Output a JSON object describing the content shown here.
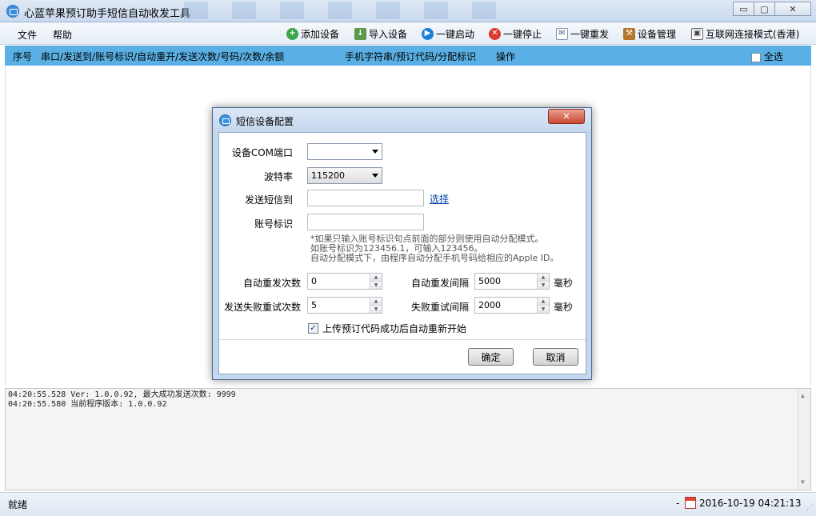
{
  "window": {
    "title": "心蓝苹果预订助手短信自动收发工具",
    "minimize": "▭",
    "maximize": "▢",
    "close": "✕"
  },
  "menu": {
    "file": "文件",
    "help": "帮助"
  },
  "toolbar": {
    "add_device": "添加设备",
    "import_device": "导入设备",
    "start_all": "一键启动",
    "stop_all": "一键停止",
    "resend_all": "一键重发",
    "device_manage": "设备管理",
    "internet_mode": "互联网连接模式(香港)"
  },
  "icons": {
    "add": "+",
    "import": "↓",
    "start": "▶",
    "stop": "✕",
    "resend": "✉",
    "manage": "⚒",
    "net": "▣"
  },
  "list_header": {
    "index": "序号",
    "port_info": "串口/发送到/账号标识/自动重开/发送次数/号码/次数/余额",
    "phone_info": "手机字符串/预订代码/分配标识",
    "action": "操作",
    "select_all": "全选"
  },
  "log": {
    "lines": [
      "04:20:55.528 Ver: 1.0.0.92, 最大成功发送次数: 9999",
      "04:20:55.580 当前程序版本: 1.0.0.92"
    ]
  },
  "statusbar": {
    "status": "就绪",
    "dash": "-",
    "datetime": "2016-10-19 04:21:13"
  },
  "dialog": {
    "title": "短信设备配置",
    "close": "✕",
    "com_port_label": "设备COM端口",
    "com_port_value": "",
    "baud_label": "波特率",
    "baud_value": "115200",
    "send_to_label": "发送短信到",
    "send_to_value": "",
    "select_link": "选择",
    "account_label": "账号标识",
    "account_value": "",
    "note_lines": [
      "*如果只输入账号标识句点前面的部分则使用自动分配模式。",
      "如账号标识为123456.1，可输入123456。",
      "自动分配模式下，由程序自动分配手机号码给相应的Apple ID。"
    ],
    "auto_resend_count_label": "自动重发次数",
    "auto_resend_count_value": "0",
    "auto_resend_interval_label": "自动重发间隔",
    "auto_resend_interval_value": "5000",
    "fail_retry_count_label": "发送失败重试次数",
    "fail_retry_count_value": "5",
    "fail_retry_interval_label": "失败重试间隔",
    "fail_retry_interval_value": "2000",
    "ms_unit": "毫秒",
    "restart_checkbox_label": "上传预订代码成功后自动重新开始",
    "restart_checked": true,
    "ok": "确定",
    "cancel": "取消"
  }
}
